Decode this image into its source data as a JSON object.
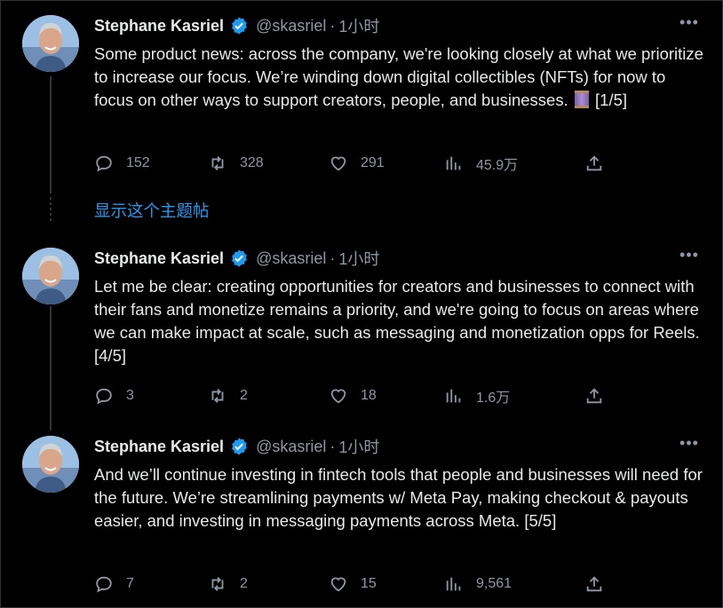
{
  "show_thread_label": "显示这个主题帖",
  "tweets": [
    {
      "name": "Stephane Kasriel",
      "handle": "@skasriel",
      "separator": "·",
      "time": "1小时",
      "text": "Some product news: across the company, we're looking closely at what we prioritize to increase our focus. We’re winding down digital collectibles (NFTs) for now to focus on other ways to support creators, people, and businesses.",
      "text_suffix": "[1/5]",
      "emoji_icon": "spool-of-thread-icon",
      "stats": {
        "replies": "152",
        "retweets": "328",
        "likes": "291",
        "views": "45.9万"
      }
    },
    {
      "name": "Stephane Kasriel",
      "handle": "@skasriel",
      "separator": "·",
      "time": "1小时",
      "text": "Let me be clear: creating opportunities for creators and businesses to connect with their fans and monetize remains a priority, and we're going to focus on areas where we can make impact at scale, such as messaging and monetization opps for Reels. [4/5]",
      "stats": {
        "replies": "3",
        "retweets": "2",
        "likes": "18",
        "views": "1.6万"
      }
    },
    {
      "name": "Stephane Kasriel",
      "handle": "@skasriel",
      "separator": "·",
      "time": "1小时",
      "text": "And we’ll continue investing in fintech tools that people and businesses will need for the future. We’re streamlining payments w/ Meta Pay, making checkout & payouts easier, and investing in messaging payments across Meta. [5/5]",
      "stats": {
        "replies": "7",
        "retweets": "2",
        "likes": "15",
        "views": "9,561"
      }
    }
  ],
  "colors": {
    "background": "#000000",
    "text": "#e7e9ea",
    "muted": "#8b98a5",
    "link": "#1d9bf0",
    "verified": "#1d9bf0"
  }
}
